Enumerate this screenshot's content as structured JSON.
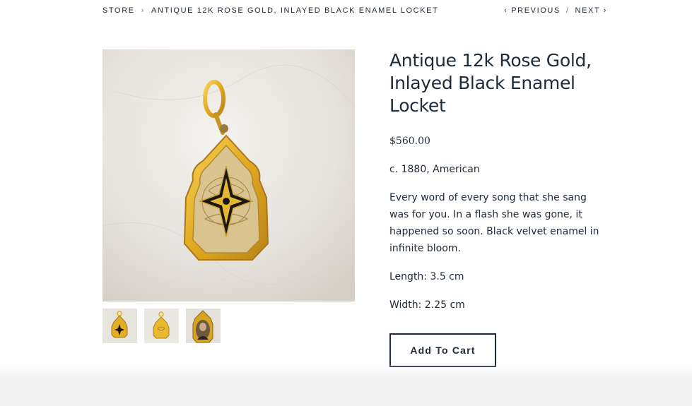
{
  "breadcrumb": {
    "store": "STORE",
    "separator": "›",
    "current": "ANTIQUE 12K ROSE GOLD, INLAYED BLACK ENAMEL LOCKET"
  },
  "pager": {
    "previous": "‹ PREVIOUS",
    "slash": "/",
    "next": "NEXT ›"
  },
  "product": {
    "title": "Antique 12k Rose Gold, Inlayed Black Enamel Locket",
    "price": "$560.00",
    "origin": "c. 1880, American",
    "description": "Every word of every song that she sang was for you. In a flash she was gone, it happened so soon. Black velvet enamel in infinite bloom.",
    "length": "Length: 3.5 cm",
    "width": "Width: 2.25 cm",
    "add_to_cart": "Add To Cart"
  },
  "colors": {
    "text": "#1e2a3a",
    "gold": "#e2b22c",
    "marble": "#e8e5e0"
  }
}
